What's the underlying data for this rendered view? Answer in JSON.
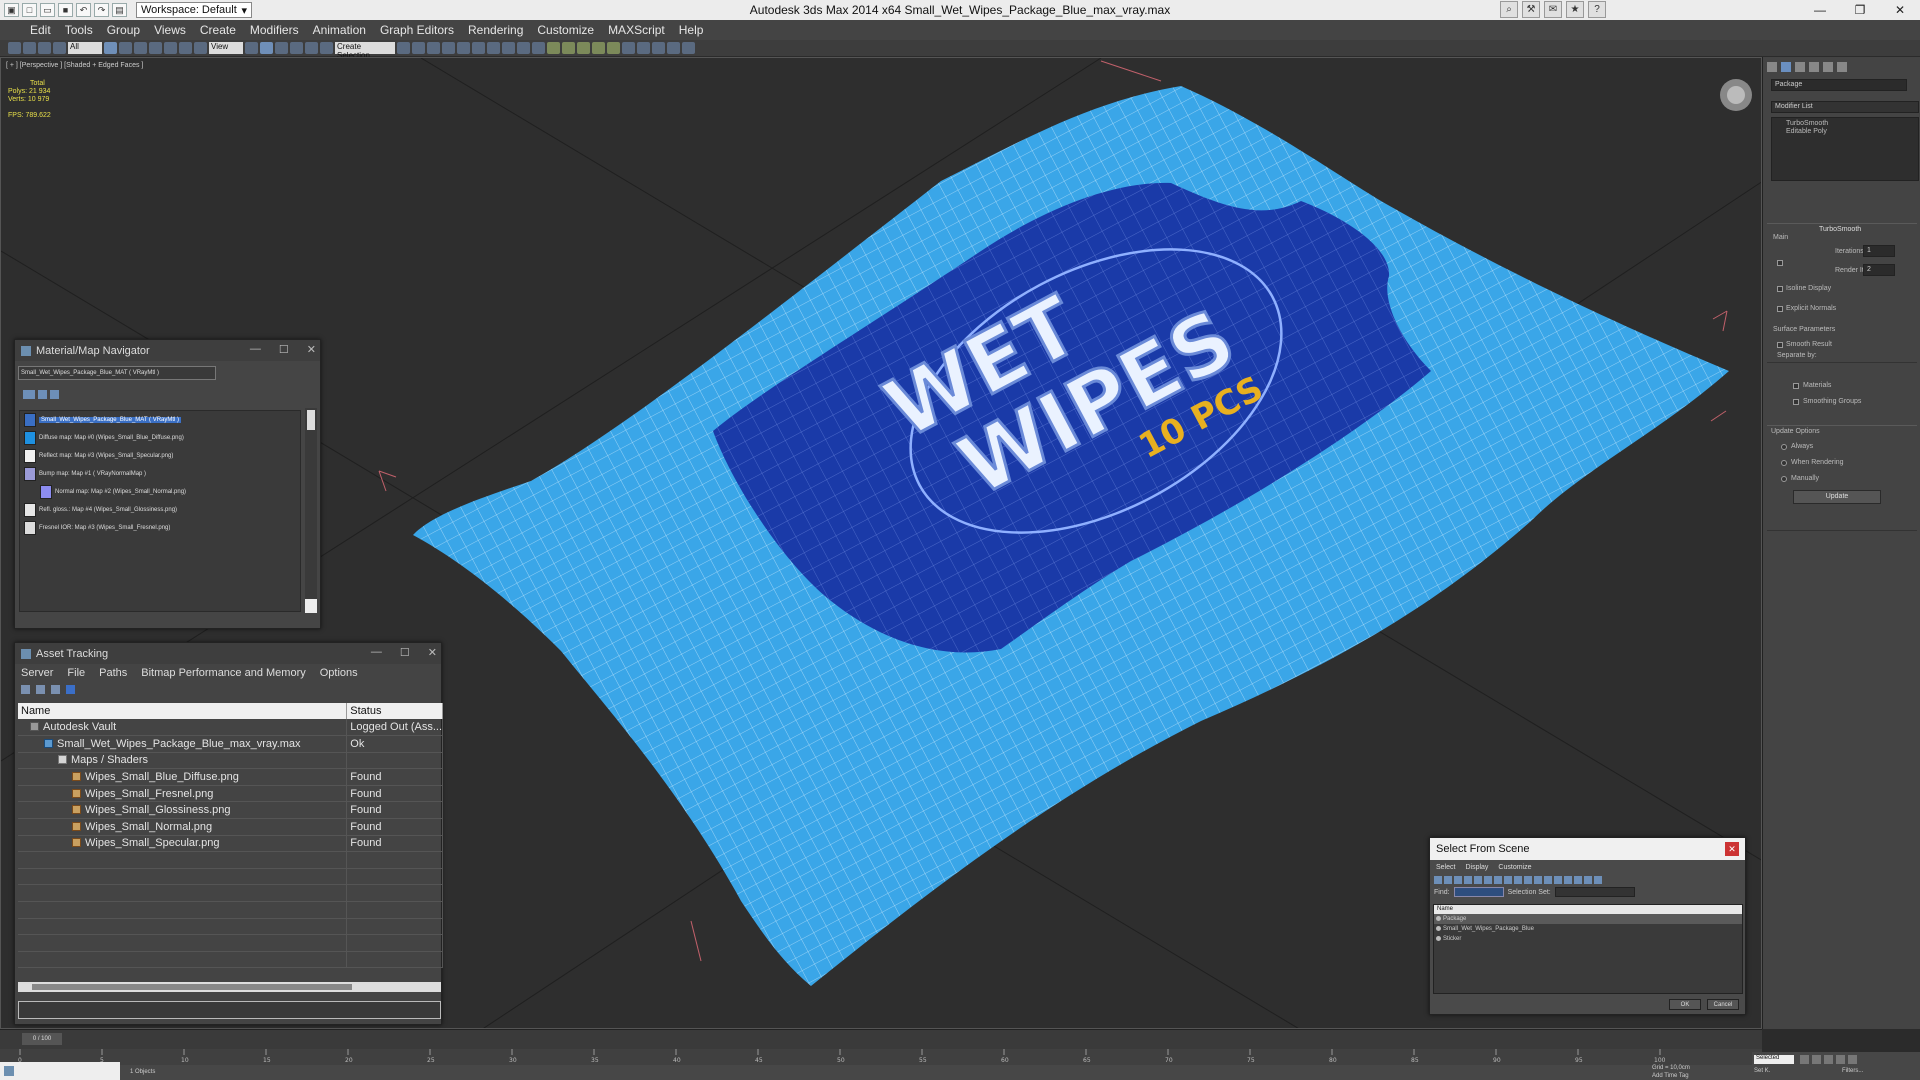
{
  "titlebar": {
    "workspace_label": "Workspace: Default",
    "app_title": "Autodesk 3ds Max  2014 x64     Small_Wet_Wipes_Package_Blue_max_vray.max"
  },
  "menu": [
    "Edit",
    "Tools",
    "Group",
    "Views",
    "Create",
    "Modifiers",
    "Animation",
    "Graph Editors",
    "Rendering",
    "Customize",
    "MAXScript",
    "Help"
  ],
  "toolbar": {
    "selection_filter": "All",
    "view_label": "View",
    "named_sel": "Create Selection"
  },
  "viewport": {
    "label": "[ + ] [Perspective ] [Shaded + Edged Faces ]",
    "stats_total": "Total",
    "polys_label": "Polys:",
    "polys_value": "21 934",
    "verts_label": "Verts:",
    "verts_value": "10 979",
    "fps_label": "FPS:",
    "fps_value": "789.622",
    "package_text_1": "WET",
    "package_text_2": "WIPES",
    "package_text_3": "10 PCS"
  },
  "command_panel": {
    "object_name": "Package",
    "modifier_list": "Modifier List",
    "stack": [
      "TurboSmooth",
      "Editable Poly"
    ],
    "rollout_title": "TurboSmooth",
    "main_label": "Main",
    "iterations_label": "Iterations:",
    "iterations_value": "1",
    "render_iters_label": "Render Iters:",
    "render_iters_value": "2",
    "isoline_label": "Isoline Display",
    "explicit_label": "Explicit Normals",
    "surface_label": "Surface Parameters",
    "smooth_result_label": "Smooth Result",
    "separate_label": "Separate by:",
    "materials_label": "Materials",
    "smoothing_groups_label": "Smoothing Groups",
    "update_options_label": "Update Options",
    "always_label": "Always",
    "when_rendering_label": "When Rendering",
    "manually_label": "Manually",
    "update_button": "Update"
  },
  "material_navigator": {
    "title": "Material/Map Navigator",
    "current": "Small_Wet_Wipes_Package_Blue_MAT  ( VRayMtl )",
    "items": [
      {
        "label": "Small_Wet_Wipes_Package_Blue_MAT  ( VRayMtl )",
        "color": "#3a6fc4"
      },
      {
        "label": "Diffuse map: Map #0 (Wipes_Small_Blue_Diffuse.png)",
        "color": "#1e90e0"
      },
      {
        "label": "Reflect map: Map #3 (Wipes_Small_Specular.png)",
        "color": "#f2f2f2"
      },
      {
        "label": "Bump map: Map #1  ( VRayNormalMap )",
        "color": "#9a9ad8"
      },
      {
        "label": "Normal map: Map #2 (Wipes_Small_Normal.png)",
        "color": "#8c8cf0"
      },
      {
        "label": "Refl. gloss.: Map #4 (Wipes_Small_Glossiness.png)",
        "color": "#e6e6e6"
      },
      {
        "label": "Fresnel IOR: Map #3 (Wipes_Small_Fresnel.png)",
        "color": "#dcdcdc"
      }
    ]
  },
  "asset_tracking": {
    "title": "Asset Tracking",
    "menu": [
      "Server",
      "File",
      "Paths",
      "Bitmap Performance and Memory",
      "Options"
    ],
    "columns": [
      "Name",
      "Status"
    ],
    "rows": [
      {
        "name": "Autodesk Vault",
        "status": "Logged Out (Ass...",
        "indent": 0,
        "icon": "vault"
      },
      {
        "name": "Small_Wet_Wipes_Package_Blue_max_vray.max",
        "status": "Ok",
        "indent": 1,
        "icon": "max"
      },
      {
        "name": "Maps / Shaders",
        "status": "",
        "indent": 2,
        "icon": "folder"
      },
      {
        "name": "Wipes_Small_Blue_Diffuse.png",
        "status": "Found",
        "indent": 3,
        "icon": "image"
      },
      {
        "name": "Wipes_Small_Fresnel.png",
        "status": "Found",
        "indent": 3,
        "icon": "image"
      },
      {
        "name": "Wipes_Small_Glossiness.png",
        "status": "Found",
        "indent": 3,
        "icon": "image"
      },
      {
        "name": "Wipes_Small_Normal.png",
        "status": "Found",
        "indent": 3,
        "icon": "image"
      },
      {
        "name": "Wipes_Small_Specular.png",
        "status": "Found",
        "indent": 3,
        "icon": "image"
      }
    ]
  },
  "select_from_scene": {
    "title": "Select From Scene",
    "menu": [
      "Select",
      "Display",
      "Customize"
    ],
    "find_label": "Find:",
    "selection_set_label": "Selection Set:",
    "column": "Name",
    "items": [
      "Package",
      "Small_Wet_Wipes_Package_Blue",
      "Sticker"
    ],
    "ok": "OK",
    "cancel": "Cancel"
  },
  "timeline": {
    "frame": "0 / 100",
    "ticks": [
      "0",
      "5",
      "10",
      "15",
      "20",
      "25",
      "30",
      "35",
      "40",
      "45",
      "50",
      "55",
      "60",
      "65",
      "70",
      "75",
      "80",
      "85",
      "90",
      "95",
      "100"
    ]
  },
  "status": {
    "selected": "Selected",
    "grid": "Grid = 10,0cm",
    "add_time_tag": "Add Time Tag",
    "objects": "1 Objects",
    "set_key": "Set K.",
    "filters": "Filters..."
  },
  "colors": {
    "package_light": "#3aa6e8",
    "package_dark": "#1a3aa8",
    "label_yellow": "#e8b020"
  }
}
